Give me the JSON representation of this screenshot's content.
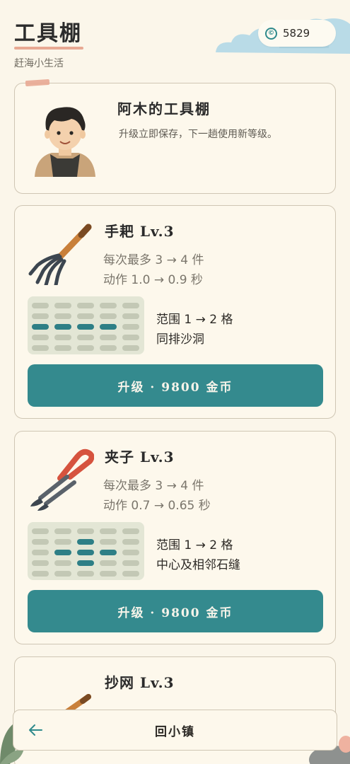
{
  "header": {
    "title": "工具棚",
    "subtitle": "赶海小生活",
    "coins": "5829",
    "coin_icon": "coin-icon"
  },
  "owner": {
    "name": "阿木的工具棚",
    "description": "升级立即保存，下一趟使用新等级。"
  },
  "tools": [
    {
      "name": "手耙 Lv.3",
      "stat1": "每次最多 3 → 4 件",
      "stat2": "动作 1.0 → 0.9 秒",
      "range": "范围 1 → 2 格",
      "pattern": "同排沙洞",
      "upgrade_label": "升级 · 9800 金币",
      "icon": "rake-icon"
    },
    {
      "name": "夹子 Lv.3",
      "stat1": "每次最多 3 → 4 件",
      "stat2": "动作 0.7 → 0.65 秒",
      "range": "范围 1 → 2 格",
      "pattern": "中心及相邻石缝",
      "upgrade_label": "升级 · 9800 金币",
      "icon": "tongs-icon"
    },
    {
      "name": "抄网 Lv.3",
      "icon": "net-icon"
    }
  ],
  "footer": {
    "back_label": "回小镇",
    "back_icon": "arrow-left-icon"
  },
  "colors": {
    "accent": "#348a8e",
    "background": "#fbf6ea",
    "highlight": "#2e7f86"
  }
}
